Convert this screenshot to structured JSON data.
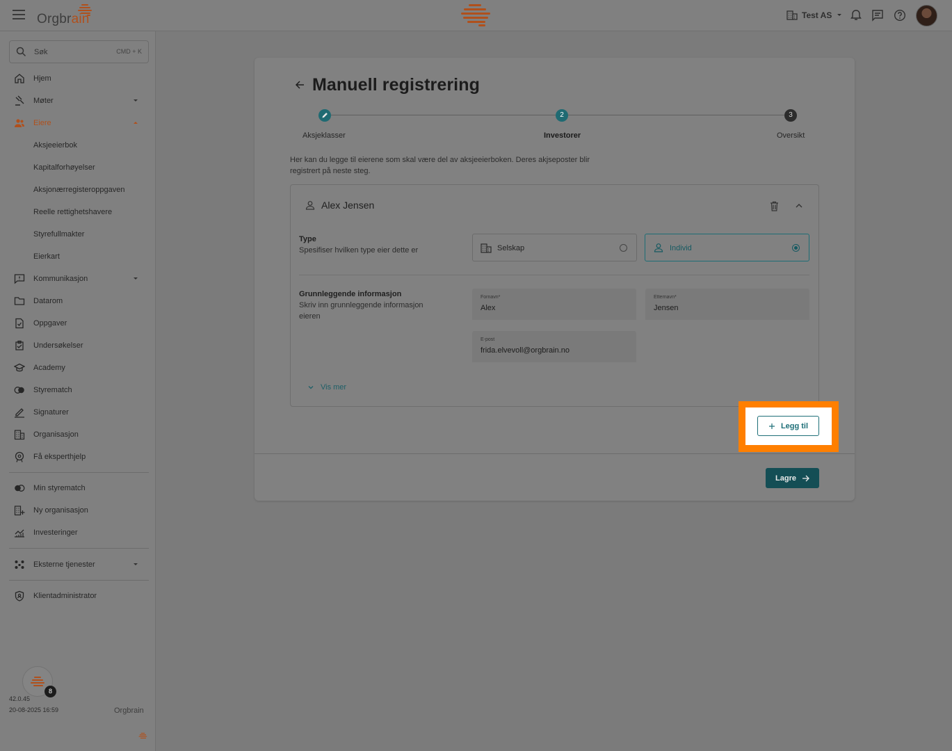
{
  "app": {
    "brand_name": "Orgbrain",
    "brand_prefix": "Orgbr",
    "brand_accent": "ain",
    "brand_color": "#b0501c",
    "accent_color": "#1e6f78"
  },
  "topbar": {
    "menu_icon": "hamburger-icon",
    "org_name": "Test AS",
    "org_icon": "building-icon",
    "icons": [
      "bell-icon",
      "chat-icon",
      "help-icon"
    ]
  },
  "sidebar": {
    "search": {
      "label": "Søk",
      "shortcut": "CMD + K"
    },
    "items": [
      {
        "label": "Hjem",
        "icon": "home-icon"
      },
      {
        "label": "Møter",
        "icon": "gavel-icon",
        "expandable": true
      },
      {
        "label": "Eiere",
        "icon": "people-icon",
        "expandable": true,
        "active": true
      },
      {
        "label": "Kommunikasjon",
        "icon": "message-icon",
        "expandable": true
      },
      {
        "label": "Datarom",
        "icon": "folder-icon"
      },
      {
        "label": "Oppgaver",
        "icon": "task-icon"
      },
      {
        "label": "Undersøkelser",
        "icon": "survey-icon"
      },
      {
        "label": "Academy",
        "icon": "academy-icon"
      },
      {
        "label": "Styrematch",
        "icon": "match-icon"
      },
      {
        "label": "Signaturer",
        "icon": "signature-icon"
      },
      {
        "label": "Organisasjon",
        "icon": "building-icon"
      },
      {
        "label": "Få eksperthjelp",
        "icon": "expert-icon"
      }
    ],
    "eiere_sub": [
      "Aksjeeierbok",
      "Kapitalforhøyelser",
      "Aksjonærregisteroppgaven",
      "Reelle rettighetshavere",
      "Styrefullmakter",
      "Eierkart"
    ],
    "secondary": [
      {
        "label": "Min styrematch",
        "icon": "match-icon"
      },
      {
        "label": "Ny organisasjon",
        "icon": "add-building-icon"
      },
      {
        "label": "Investeringer",
        "icon": "chart-icon"
      }
    ],
    "external": {
      "label": "Eksterne tjenester",
      "icon": "services-icon"
    },
    "admin": {
      "label": "Klientadministrator",
      "icon": "shield-icon"
    },
    "version": "42.0.45",
    "timestamp": "20-08-2025 16:59",
    "notification_count": "8",
    "footer_brand": "Orgbrain"
  },
  "main": {
    "title": "Manuell registrering",
    "steps": [
      {
        "number": "",
        "label": "Aksjeklasser",
        "state": "done"
      },
      {
        "number": "2",
        "label": "Investorer",
        "state": "active"
      },
      {
        "number": "3",
        "label": "Oversikt",
        "state": "todo"
      }
    ],
    "description": "Her kan du legge til eierene som skal være del av aksjeeierboken. Deres akjseposter blir registrert på neste steg.",
    "owner": {
      "name": "Alex Jensen",
      "type_section": {
        "title": "Type",
        "subtitle": "Spesifiser hvilken type eier dette er",
        "options": [
          {
            "label": "Selskap",
            "icon": "building-icon",
            "selected": false
          },
          {
            "label": "Individ",
            "icon": "person-icon",
            "selected": true
          }
        ]
      },
      "basic_section": {
        "title": "Grunnleggende informasjon",
        "subtitle": "Skriv inn grunnleggende informasjon eieren",
        "first_name": {
          "label": "Fornavn*",
          "value": "Alex"
        },
        "last_name": {
          "label": "Etternavn*",
          "value": "Jensen"
        },
        "email": {
          "label": "E-post",
          "value": "frida.elvevoll@orgbrain.no"
        }
      },
      "show_more": "Vis mer"
    },
    "add_label": "Legg til",
    "save_label": "Lagre",
    "highlight_color": "#ff7f00"
  }
}
